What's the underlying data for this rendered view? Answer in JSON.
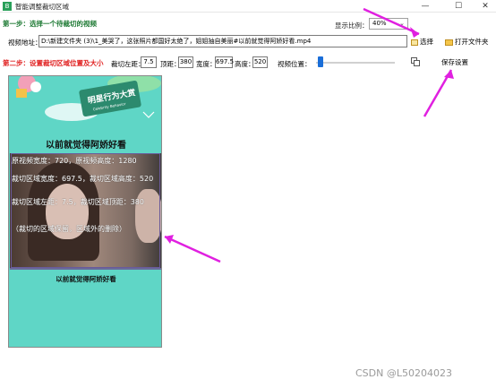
{
  "window": {
    "title": "智能调整裁切区域",
    "icon_label": "B",
    "controls": {
      "minimize": "—",
      "maximize": "☐",
      "close": "✕"
    }
  },
  "step1": {
    "label": "第一步：选择一个待裁切的视频",
    "ratio_label": "显示比例：",
    "ratio_value": "40%"
  },
  "path": {
    "label": "视频地址：",
    "value": "D:\\新建文件夹 (3)\\1_美哭了，这张照片都国好太绝了，姐姐抽自美丽#以前就觉得阿娇好看.mp4",
    "select_label": "选择",
    "open_folder_label": "打开文件夹"
  },
  "step2": {
    "label": "第二步：设置裁切区域位置及大小",
    "crop_left_label": "裁切左距：",
    "crop_left_value": "7.5",
    "top_label": "顶距：",
    "top_value": "380",
    "width_label": "宽度：",
    "width_value": "697.5",
    "height_label": "高度：",
    "height_value": "520",
    "position_label": "视频位置：",
    "position_fraction": 0.03,
    "save_label": "保存设置"
  },
  "preview": {
    "banner_text": "明星行为大赏",
    "banner_sub": "Celebrity Behavior",
    "headline": "以前就觉得阿娇好看",
    "lines": [
      "原视频宽度：720，原视频高度：1280",
      "裁切区域宽度：697.5，裁切区域高度：520",
      "裁切区域左距：7.5，裁切区域顶距：380",
      "（裁切的区域保留，区域外的删除）"
    ],
    "caption": "以前就觉得阿娇好看"
  },
  "watermark": "CSDN @L50204023",
  "colors": {
    "step1": "#1e7a34",
    "step2": "#e02020",
    "preview_bg": "#5fd6c6",
    "arrow": "#e020e0",
    "slider": "#1a6ed8"
  }
}
